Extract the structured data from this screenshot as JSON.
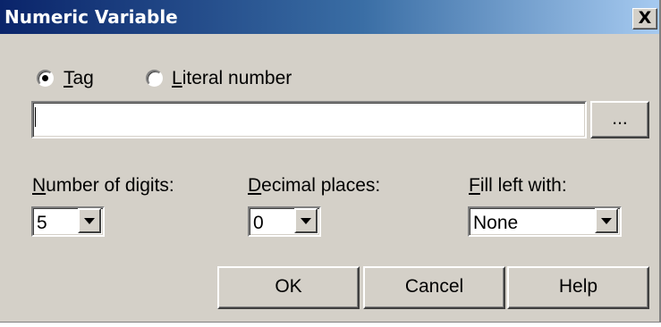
{
  "window": {
    "title": "Numeric Variable",
    "close_glyph": "X"
  },
  "source": {
    "tag_label": "Tag",
    "tag_underline_char": "T",
    "tag_rest": "ag",
    "literal_underline_char": "L",
    "literal_rest": "iteral number",
    "selected": "tag",
    "tag_value": "",
    "browse_label": "..."
  },
  "format": {
    "digits_label_u": "N",
    "digits_label_rest": "umber of digits:",
    "digits_value": "5",
    "decimals_label_u": "D",
    "decimals_label_rest": "ecimal places:",
    "decimals_value": "0",
    "fill_label_u": "F",
    "fill_label_rest": "ill left with:",
    "fill_value": "None"
  },
  "buttons": {
    "ok": "OK",
    "cancel": "Cancel",
    "help": "Help"
  },
  "icons": {
    "dropdown": "chevron-down-icon",
    "close": "close-icon"
  }
}
